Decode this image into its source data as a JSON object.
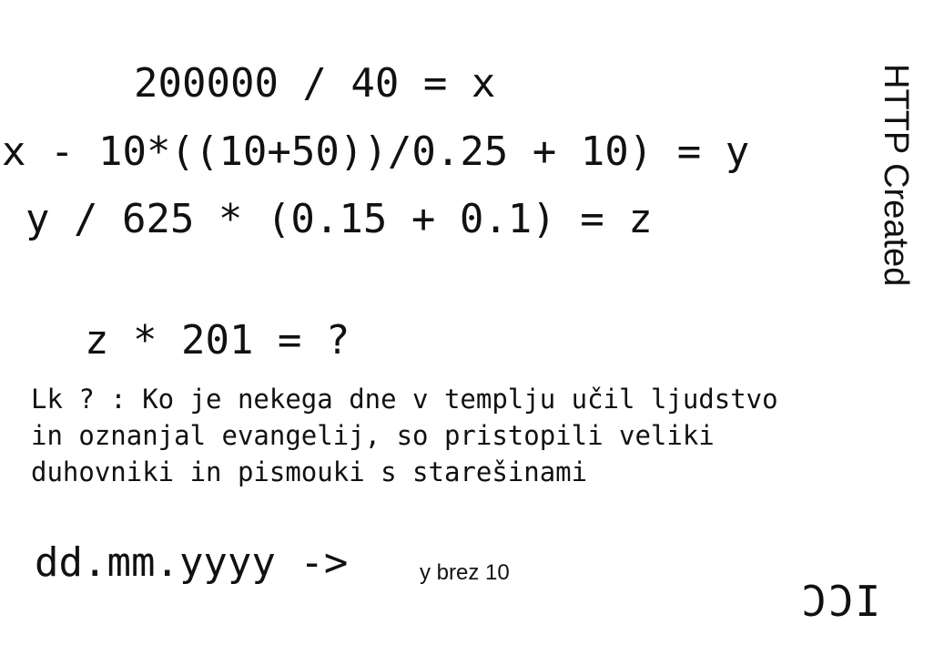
{
  "equations": {
    "line1": "200000 / 40 = x",
    "line2": "x - 10*((10+50))/0.25 + 10) = y",
    "line3": "y / 625 * (0.15 + 0.1) = z",
    "line4": "z * 201 = ?"
  },
  "riddle": {
    "line1": "Lk ? : Ko je nekega dne v templju učil ljudstvo",
    "line2": "in oznanjal evangelij, so pristopili veliki",
    "line3": "duhovniki in pismouki s starešinami"
  },
  "date_format": {
    "pattern": "dd.mm.yyyy ->",
    "note": "y brez 10"
  },
  "side_label": "HTTP Created",
  "corner_mark": "ICC"
}
